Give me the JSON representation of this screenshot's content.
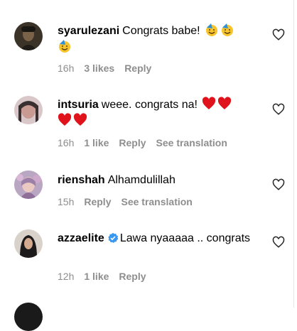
{
  "comments": [
    {
      "username": "syarulezani",
      "text": "Congrats babe!",
      "emoji_icon": "face-with-party-hat",
      "emoji_count": 3,
      "time": "16h",
      "likes": "3 likes",
      "reply": "Reply",
      "see_translation": ""
    },
    {
      "username": "intsuria",
      "text": "weee. congrats na!",
      "emoji_icon": "red-heart",
      "emoji_count": 4,
      "time": "16h",
      "likes": "1 like",
      "reply": "Reply",
      "see_translation": "See translation"
    },
    {
      "username": "rienshah",
      "text": "Alhamdulillah",
      "time": "15h",
      "likes": "",
      "reply": "Reply",
      "see_translation": "See translation"
    },
    {
      "username": "azzaelite",
      "verified": true,
      "text": "Lawa nyaaaaa .. congrats",
      "time": "12h",
      "likes": "1 like",
      "reply": "Reply",
      "see_translation": ""
    }
  ],
  "colors": {
    "text": "#000000",
    "meta": "#8e8e8e",
    "verified_blue": "#3897f0",
    "heart_red": "#e0131c"
  }
}
